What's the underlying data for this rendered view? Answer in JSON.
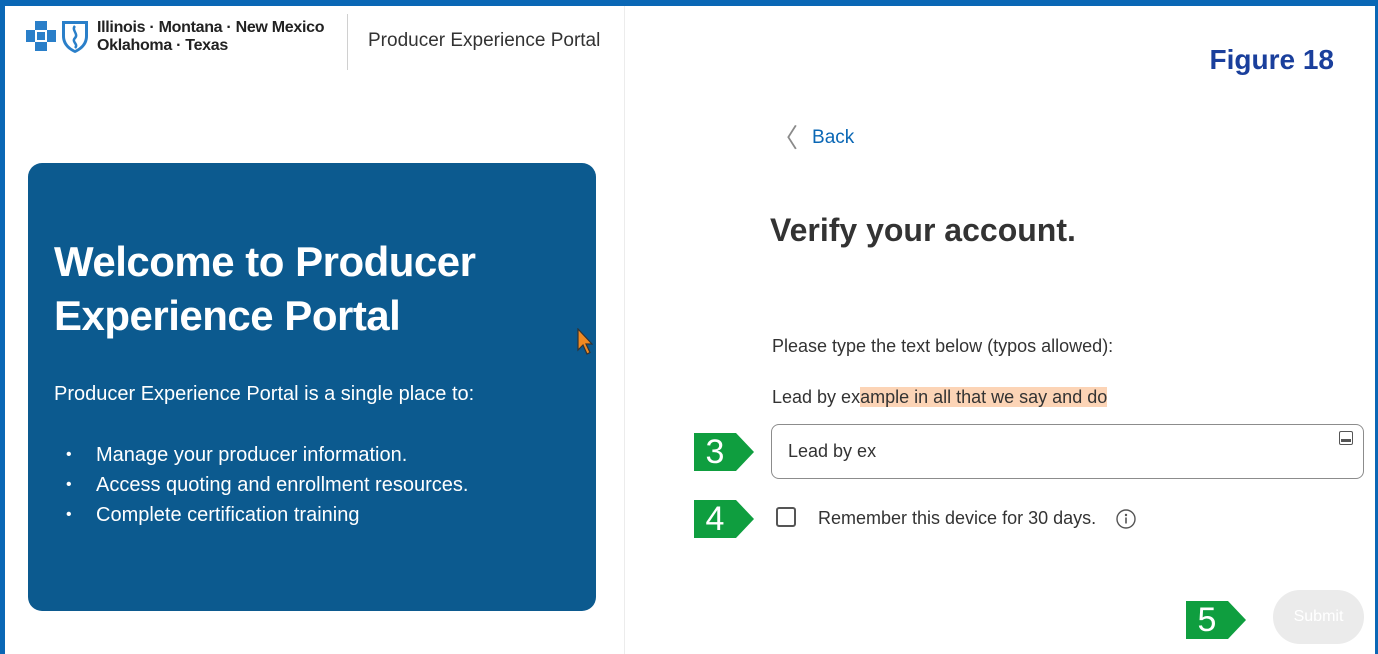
{
  "header": {
    "brand_line1": "Illinois · Montana · New Mexico",
    "brand_line2": "Oklahoma · Texas",
    "portal_name": "Producer Experience Portal"
  },
  "figure_label": "Figure 18",
  "welcome": {
    "title": "Welcome to Producer Experience Portal",
    "subtitle": "Producer Experience Portal is a single place to:",
    "items": [
      "Manage your producer information.",
      "Access quoting and enrollment resources.",
      "Complete certification training"
    ],
    "bullet": "•"
  },
  "verify": {
    "back_label": "Back",
    "title": "Verify your account.",
    "instruction": "Please type the text below (typos allowed):",
    "phrase_typed": "Lead by ex",
    "phrase_remaining": "ample in all that we say and do",
    "input_value": "Lead by ex",
    "remember_label": "Remember this device for 30 days.",
    "submit_label": "Submit"
  },
  "callouts": [
    "3",
    "4",
    "5"
  ],
  "colors": {
    "brand_blue": "#0a67b5",
    "card_blue": "#0c5a8f",
    "highlight": "#fcd4b6",
    "callout_green": "#0f9e3f",
    "figure_label": "#1a3f9c"
  },
  "icons": [
    "bcbs-cross-icon",
    "bcbs-shield-icon",
    "chevron-left-icon",
    "keyboard-icon",
    "info-icon",
    "mouse-cursor-icon"
  ]
}
